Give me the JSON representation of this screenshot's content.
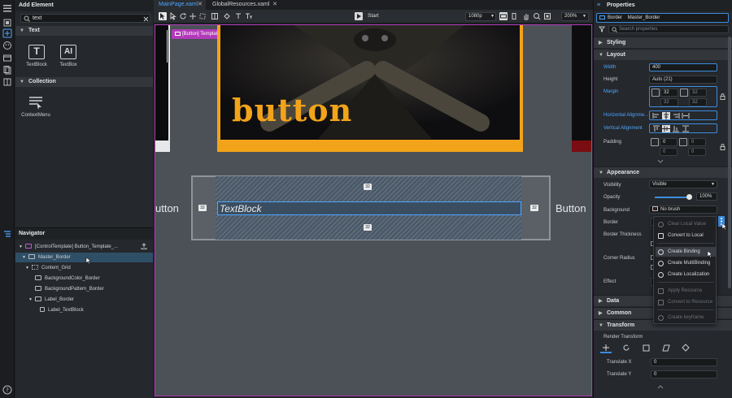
{
  "add_element": {
    "title": "Add Element",
    "search_value": "text",
    "sections": [
      {
        "label": "Text",
        "items": [
          "TextBlock",
          "TextBox"
        ]
      },
      {
        "label": "Collection",
        "items": [
          "ContextMenu"
        ]
      }
    ]
  },
  "navigator": {
    "title": "Navigator",
    "items": [
      {
        "label": "[ControlTemplate] Button_Template_..."
      },
      {
        "label": "Master_Border"
      },
      {
        "label": "Content_Grid"
      },
      {
        "label": "BackgroundColor_Border"
      },
      {
        "label": "BackgroundPattern_Border"
      },
      {
        "label": "Label_Border"
      },
      {
        "label": "Label_TextBlock"
      }
    ]
  },
  "tabs": [
    {
      "label": "MainPage.xaml",
      "active": true
    },
    {
      "label": "GlobalResources.xaml",
      "active": false
    }
  ],
  "toolbar": {
    "start_label": "Start",
    "resolution": "1080p",
    "zoom": "200%"
  },
  "canvas": {
    "breadcrumb": "[Button] Template",
    "preview_text": "button",
    "left_ghost": "utton",
    "right_ghost": "Button",
    "textblock_label": "TextBlock",
    "margin_top": "32",
    "margin_bottom": "32",
    "margin_left": "32",
    "margin_right": "32"
  },
  "properties": {
    "title": "Properties",
    "element_type": "Border",
    "element_name": "Master_Border",
    "search_placeholder": "Search properties",
    "sections": {
      "styling": "Styling",
      "layout": "Layout",
      "appearance": "Appearance",
      "data": "Data",
      "common": "Common",
      "transform": "Transform"
    },
    "width_label": "Width",
    "width_value": "400",
    "height_label": "Height",
    "height_value": "Auto (21)",
    "margin_label": "Margin",
    "margin_values": [
      "32",
      "32",
      "32",
      "32"
    ],
    "halign_label": "Horizontal Alignme...",
    "valign_label": "Vertical Alignment",
    "padding_label": "Padding",
    "padding_values": [
      "0",
      "0",
      "0",
      "0"
    ],
    "visibility_label": "Visibility",
    "visibility_value": "Visible",
    "opacity_label": "Opacity",
    "opacity_value": "100%",
    "opacity_fraction": 1.0,
    "background_label": "Background",
    "background_value": "No brush",
    "border_label": "Border",
    "border_thickness_label": "Border Thickness",
    "corner_radius_label": "Corner Radius",
    "effect_label": "Effect",
    "render_transform_label": "Render Transform",
    "translate_x_label": "Translate X",
    "translate_x_value": "0",
    "translate_y_label": "Translate Y",
    "translate_y_value": "0"
  },
  "context_menu": {
    "items": [
      {
        "label": "Clear Local Value",
        "disabled": true
      },
      {
        "label": "Convert to Local",
        "disabled": false
      },
      {
        "label": "Create Binding",
        "disabled": false,
        "hovered": true
      },
      {
        "label": "Create MultiBinding",
        "disabled": false
      },
      {
        "label": "Create Localization",
        "disabled": false
      },
      {
        "label": "Apply Resource",
        "disabled": true
      },
      {
        "label": "Convert to Resource",
        "disabled": true
      },
      {
        "label": "Create keyframe",
        "disabled": true
      }
    ]
  },
  "colors": {
    "accent_blue": "#4fa6ff",
    "selection": "#2f4f66",
    "canvas_border": "#b23ab8",
    "preview_gold": "#f2a31a"
  }
}
